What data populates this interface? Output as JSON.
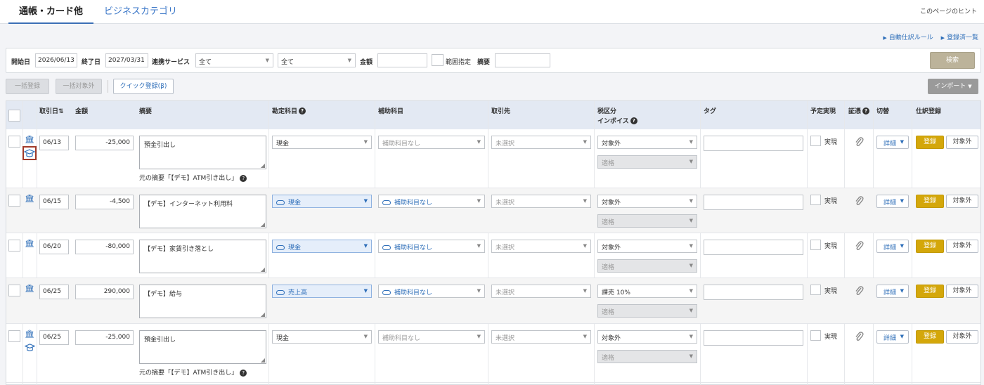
{
  "tabs": {
    "active": "通帳・カード他",
    "second": "ビジネスカテゴリ"
  },
  "hint_link": "このページのヒント",
  "top_links": {
    "auto_rules": "自動仕訳ルール",
    "registered": "登録済一覧"
  },
  "filter": {
    "start_label": "開始日",
    "start_value": "2026/06/13",
    "end_label": "終了日",
    "end_value": "2027/03/31",
    "service_label": "連携サービス",
    "service_value": "全て",
    "service2_value": "全て",
    "amount_label": "金額",
    "amount_value": "",
    "range_label": "範囲指定",
    "desc_label": "摘要",
    "desc_value": "",
    "search_button": "検索"
  },
  "actions": {
    "bulk_register": "一括登録",
    "bulk_exclude": "一括対象外",
    "quick_register": "クイック登録(β)",
    "import": "インポート"
  },
  "headers": {
    "date": "取引日",
    "sort": "⇅",
    "amount": "金額",
    "memo": "摘要",
    "account": "勘定科目",
    "subaccount": "補助科目",
    "partner": "取引先",
    "tax": "税区分",
    "invoice": "インボイス",
    "tag": "タグ",
    "planned": "予定実現",
    "evidence": "証憑",
    "switch": "切替",
    "journal": "仕訳登録"
  },
  "rows": [
    {
      "date": "06/13",
      "amount": "-25,000",
      "memo": "預金引出し",
      "note": "元の摘要「【デモ】ATM引き出し」",
      "account": "現金",
      "subaccount": "補助科目なし",
      "partner": "未選択",
      "tax": "対象外",
      "invoice": "適格",
      "planned": "実現",
      "detail": "詳細",
      "register": "登録",
      "exclude": "対象外"
    },
    {
      "date": "06/15",
      "amount": "-4,500",
      "memo": "【デモ】インターネット利用料",
      "note": "",
      "account": "現金",
      "subaccount": "補助科目なし",
      "partner": "未選択",
      "tax": "対象外",
      "invoice": "適格",
      "planned": "実現",
      "detail": "詳細",
      "register": "登録",
      "exclude": "対象外"
    },
    {
      "date": "06/20",
      "amount": "-80,000",
      "memo": "【デモ】家賃引き落とし",
      "note": "",
      "account": "現金",
      "subaccount": "補助科目なし",
      "partner": "未選択",
      "tax": "対象外",
      "invoice": "適格",
      "planned": "実現",
      "detail": "詳細",
      "register": "登録",
      "exclude": "対象外"
    },
    {
      "date": "06/25",
      "amount": "290,000",
      "memo": "【デモ】給与",
      "note": "",
      "account": "売上高",
      "subaccount": "補助科目なし",
      "partner": "未選択",
      "tax": "課売 10%",
      "invoice": "適格",
      "planned": "実現",
      "detail": "詳細",
      "register": "登録",
      "exclude": "対象外"
    },
    {
      "date": "06/25",
      "amount": "-25,000",
      "memo": "預金引出し",
      "note": "元の摘要「【デモ】ATM引き出し」",
      "account": "現金",
      "subaccount": "補助科目なし",
      "partner": "未選択",
      "tax": "対象外",
      "invoice": "適格",
      "planned": "実現",
      "detail": "詳細",
      "register": "登録",
      "exclude": "対象外"
    }
  ]
}
